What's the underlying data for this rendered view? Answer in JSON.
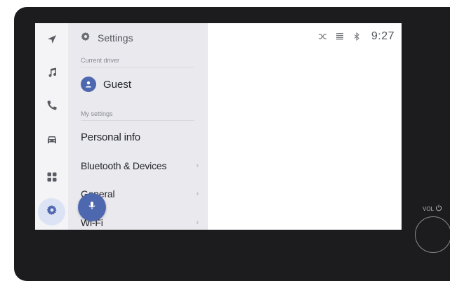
{
  "rail": {
    "items": [
      {
        "icon": "navigation-icon"
      },
      {
        "icon": "music-icon"
      },
      {
        "icon": "phone-icon"
      },
      {
        "icon": "car-icon"
      },
      {
        "icon": "apps-grid-icon"
      },
      {
        "icon": "settings-gear-icon",
        "active": true
      }
    ]
  },
  "settings": {
    "title": "Settings",
    "current_driver_label": "Current driver",
    "driver_name": "Guest",
    "my_settings_label": "My settings",
    "items": [
      {
        "label": "Personal info"
      },
      {
        "label": "Bluetooth & Devices",
        "chevron": "›"
      },
      {
        "label": "General",
        "chevron": "›"
      },
      {
        "label": "Wi-Fi",
        "chevron": "›"
      }
    ]
  },
  "status_bar": {
    "time": "9:27",
    "icons": [
      "no-signal-icon",
      "dcm-icon",
      "bluetooth-icon"
    ]
  },
  "hardware": {
    "volume_label": "VOL"
  },
  "colors": {
    "accent": "#4e68b0",
    "panel_bg": "#e9e9ee",
    "rail_active": "#dce3f4",
    "bezel": "#1c1c1e"
  }
}
